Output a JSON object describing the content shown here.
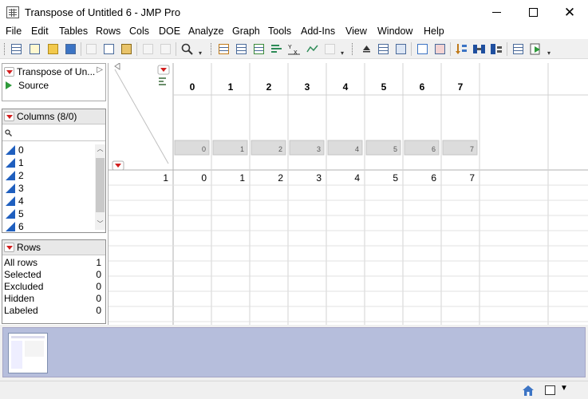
{
  "window": {
    "title": "Transpose of Untitled 6 - JMP Pro",
    "min_label": "minimize",
    "max_label": "maximize",
    "close_label": "close"
  },
  "menu": [
    "File",
    "Edit",
    "Tables",
    "Rows",
    "Cols",
    "DOE",
    "Analyze",
    "Graph",
    "Tools",
    "Add-Ins",
    "View",
    "Window",
    "Help"
  ],
  "table_panel": {
    "title": "Transpose of Un...",
    "source_label": "Source"
  },
  "columns_panel": {
    "title": "Columns (8/0)",
    "search_placeholder": "",
    "items": [
      "0",
      "1",
      "2",
      "3",
      "4",
      "5",
      "6"
    ]
  },
  "rows_panel": {
    "title": "Rows",
    "stats": [
      {
        "label": "All rows",
        "value": "1"
      },
      {
        "label": "Selected",
        "value": "0"
      },
      {
        "label": "Excluded",
        "value": "0"
      },
      {
        "label": "Hidden",
        "value": "0"
      },
      {
        "label": "Labeled",
        "value": "0"
      }
    ]
  },
  "grid": {
    "column_headers": [
      "0",
      "1",
      "2",
      "3",
      "4",
      "5",
      "6",
      "7"
    ],
    "summary_values": [
      "0",
      "1",
      "2",
      "3",
      "4",
      "5",
      "6",
      "7"
    ],
    "rows": [
      {
        "row_number": "1",
        "cells": [
          "0",
          "1",
          "2",
          "3",
          "4",
          "5",
          "6",
          "7"
        ]
      }
    ]
  },
  "colors": {
    "accent_red": "#d21f1f",
    "thumb_band": "#b6bedc",
    "column_icon_blue": "#1f5fbf"
  }
}
